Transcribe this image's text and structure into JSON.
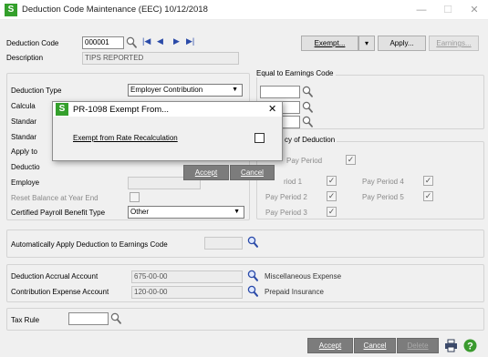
{
  "window": {
    "logo": "S",
    "title": "Deduction Code Maintenance (EEC) 10/12/2018",
    "minimize": "—",
    "maximize": "☐",
    "close": "✕"
  },
  "header": {
    "deduction_code_label": "Deduction Code",
    "deduction_code_value": "000001",
    "description_label": "Description",
    "description_value": "TIPS REPORTED",
    "exempt_label": "Exempt...",
    "exempt_dropdown": "▾",
    "apply_label": "Apply...",
    "earnings_label": "Earnings..."
  },
  "form": {
    "deduction_type_label": "Deduction Type",
    "deduction_type_value": "Employer Contribution",
    "calculation_label": "Calcula",
    "standard_label_1": "Standar",
    "standard_label_2": "Standar",
    "apply_to_label": "Apply to",
    "deduction_label": "Deductio",
    "employee_label": "Employe",
    "reset_balance_label": "Reset Balance at Year End",
    "certified_payroll_label": "Certified Payroll Benefit Type",
    "certified_payroll_value": "Other"
  },
  "equal_to_earnings": {
    "title": "Equal to Earnings Code"
  },
  "frequency": {
    "title": "cy of Deduction",
    "every_pay_period": "Pay Period",
    "pay_period_1": "riod 1",
    "pay_period_2": "Pay Period 2",
    "pay_period_3": "Pay Period 3",
    "pay_period_4": "Pay Period 4",
    "pay_period_5": "Pay Period 5",
    "check_mark": "✓"
  },
  "auto_apply": {
    "label": "Automatically Apply Deduction to Earnings Code"
  },
  "accounts": {
    "accrual_label": "Deduction Accrual Account",
    "accrual_value": "675-00-00",
    "accrual_desc": "Miscellaneous Expense",
    "contribution_label": "Contribution Expense Account",
    "contribution_value": "120-00-00",
    "contribution_desc": "Prepaid Insurance"
  },
  "tax": {
    "label": "Tax Rule"
  },
  "footer": {
    "accept": "Accept",
    "cancel": "Cancel",
    "delete": "Delete"
  },
  "dialog": {
    "logo": "S",
    "title": "PR-1098 Exempt From...",
    "close": "✕",
    "exempt_label": "Exempt from Rate Recalculation",
    "accept": "Accept",
    "cancel": "Cancel"
  },
  "colors": {
    "brand_green": "#34a02c",
    "dark_button": "#7c7c7c",
    "icon_blue": "#2a4aa8"
  }
}
